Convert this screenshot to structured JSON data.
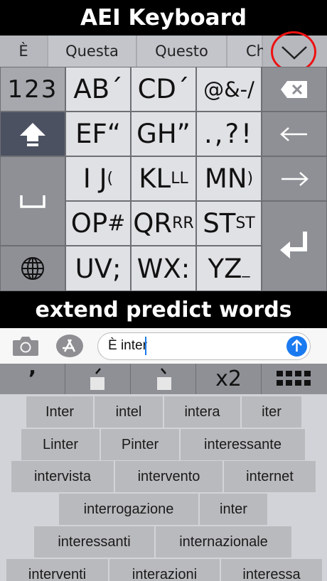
{
  "header": {
    "title": "AEI Keyboard"
  },
  "predictions": [
    "È",
    "Questa",
    "Questo",
    "Ch"
  ],
  "keys": {
    "k11": {
      "main": "AB",
      "sub": "´"
    },
    "k12": {
      "main": "CD",
      "sub": "´"
    },
    "k13": {
      "main": "@&-/",
      "sub": ""
    },
    "k21": {
      "main": "EF",
      "sub": "“"
    },
    "k22": {
      "main": "GH",
      "sub": "”"
    },
    "k23": {
      "main": ".,?!",
      "sub": ""
    },
    "k31": {
      "main": "I J",
      "sub": "("
    },
    "k32": {
      "main": "KL",
      "sub": "LL"
    },
    "k33": {
      "main": "MN",
      "sub": ")"
    },
    "k41": {
      "main": "OP",
      "sub": "#"
    },
    "k42": {
      "main": "QR",
      "sub": "RR"
    },
    "k43": {
      "main": "ST",
      "sub": "ST"
    },
    "k51": {
      "main": "UV",
      "sub": ";"
    },
    "k52": {
      "main": "WX",
      "sub": ":"
    },
    "k53": {
      "main": "YZ",
      "sub": "_"
    }
  },
  "side_keys": {
    "numbers_label": "123"
  },
  "banner": {
    "text": "extend predict words"
  },
  "message": {
    "text": "È inter"
  },
  "accent_bar": {
    "apostrophe": "’",
    "x2_label": "x2"
  },
  "suggestions": [
    "Inter",
    "intel",
    "intera",
    "iter",
    "Linter",
    "Pinter",
    "interessante",
    "intervista",
    "intervento",
    "internet",
    "interrogazione",
    "inter",
    "interessanti",
    "internazionale",
    "interventi",
    "interazioni",
    "interessa"
  ],
  "colors": {
    "accent_blue": "#1a7af0",
    "highlight_red": "#e11111"
  }
}
